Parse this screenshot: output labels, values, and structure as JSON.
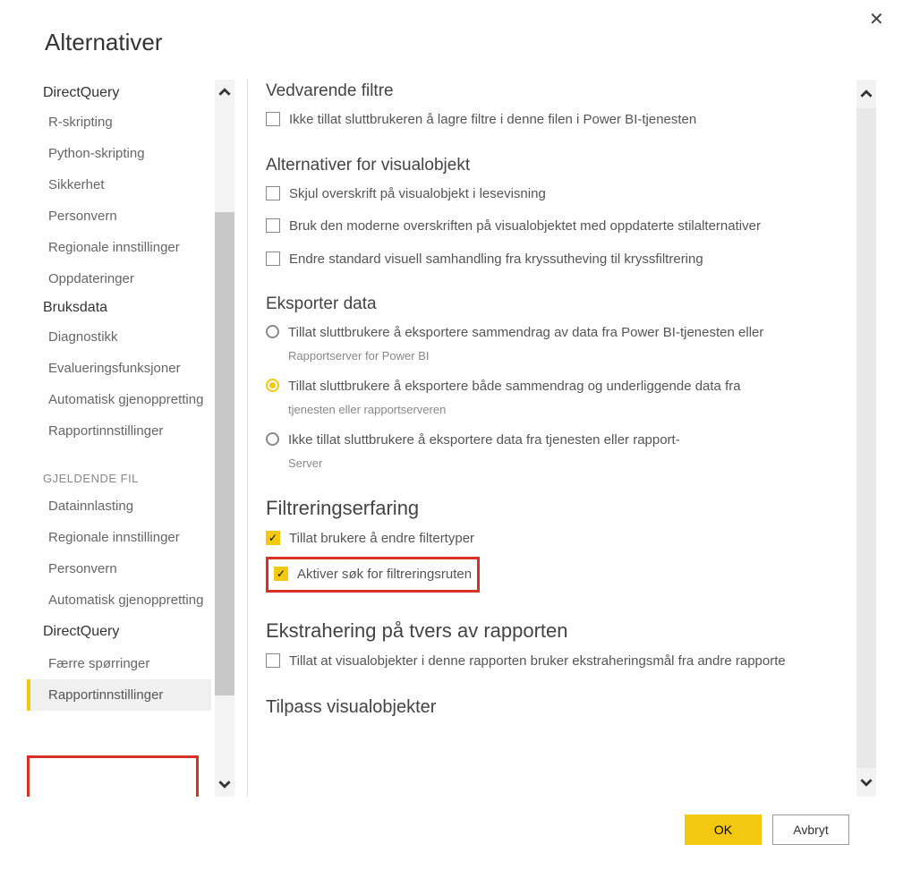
{
  "dialog": {
    "title": "Alternativer"
  },
  "sidebar": {
    "sections": [
      {
        "head": "DirectQuery",
        "items": [
          "R-skripting",
          "Python-skripting",
          "Sikkerhet",
          "Personvern",
          "Regionale innstillinger",
          "Oppdateringer"
        ]
      },
      {
        "head": "Bruksdata",
        "items": [
          "Diagnostikk",
          "Evalueringsfunksjoner",
          "Automatisk gjenoppretting",
          "Rapportinnstillinger"
        ]
      },
      {
        "head": "GJELDENDE FIL",
        "caps": true,
        "items": [
          "Datainnlasting",
          "Regionale innstillinger",
          "Personvern",
          "Automatisk gjenoppretting"
        ]
      },
      {
        "head": "DirectQuery",
        "items": [
          "Færre spørringer",
          "Rapportinnstillinger"
        ]
      }
    ]
  },
  "content": {
    "groups": {
      "persistent": {
        "title": "Vedvarende filtre",
        "opts": [
          "Ikke tillat sluttbrukeren å lagre filtre i denne filen i Power BI-tjenesten"
        ]
      },
      "visual": {
        "title": "Alternativer for visualobjekt",
        "opts": [
          "Skjul overskrift på visualobjekt i lesevisning",
          "Bruk den moderne overskriften på visualobjektet med oppdaterte stilalternativer",
          "Endre standard visuell samhandling fra kryssutheving til kryssfiltrering"
        ]
      },
      "export": {
        "title": "Eksporter data",
        "opts": [
          {
            "label": "Tillat sluttbrukere å eksportere sammendrag av data fra Power BI-tjenesten eller",
            "sub": "Rapportserver for Power BI"
          },
          {
            "label": "Tillat sluttbrukere å eksportere både sammendrag og underliggende data fra",
            "sub": "tjenesten eller rapportserveren"
          },
          {
            "label": "Ikke tillat sluttbrukere å eksportere data fra tjenesten eller rapport-",
            "sub": "Server"
          }
        ]
      },
      "filter": {
        "title": "Filtreringserfaring",
        "opts": [
          "Tillat brukere å endre filtertyper",
          "Aktiver søk for filtreringsruten"
        ]
      },
      "extract": {
        "title": "Ekstrahering på tvers av rapporten",
        "opts": [
          "Tillat at visualobjekter i denne rapporten bruker ekstraheringsmål fra andre rapporte"
        ]
      },
      "customize": {
        "title": "Tilpass visualobjekter"
      }
    }
  },
  "buttons": {
    "ok": "OK",
    "cancel": "Avbryt"
  }
}
